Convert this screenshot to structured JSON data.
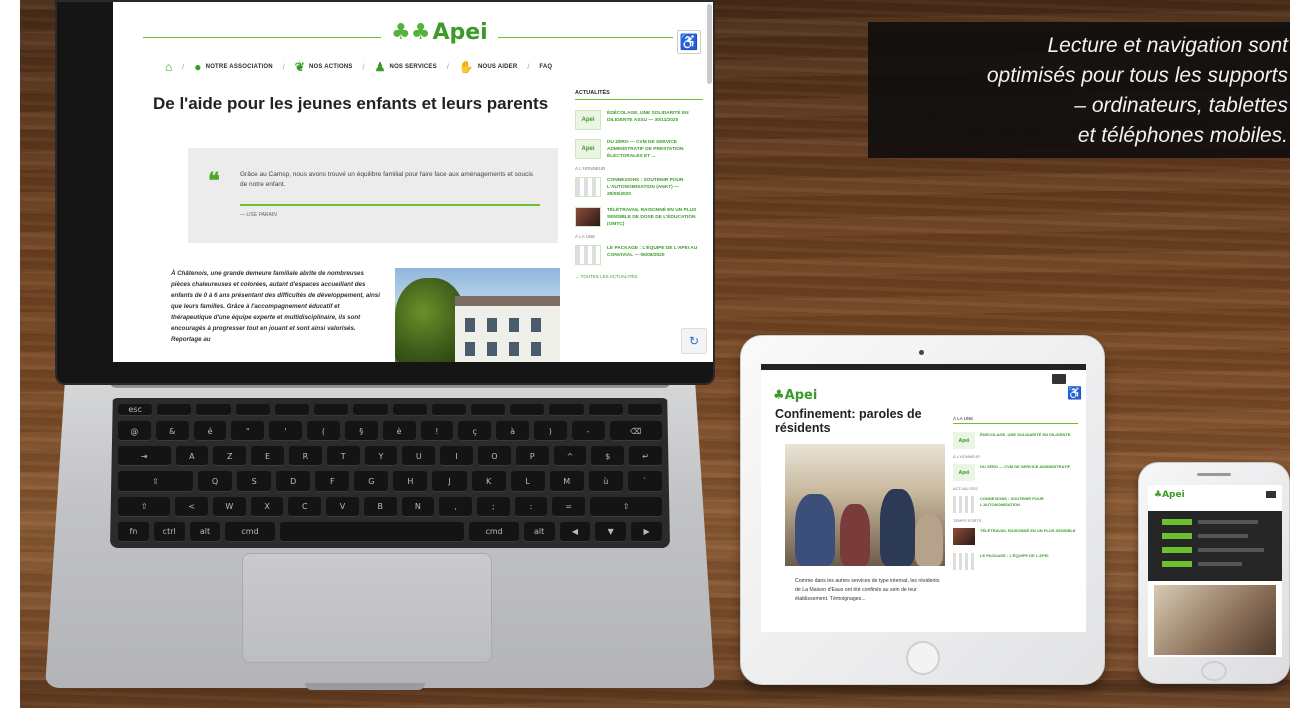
{
  "caption": {
    "line1": "Lecture et navigation sont",
    "line2": "optimisés pour tous les supports",
    "line3": "– ordinateurs, tablettes",
    "line4": "et téléphones mobiles."
  },
  "laptop_site": {
    "logo": "Apei",
    "nav": [
      "NOTRE ASSOCIATION",
      "NOS ACTIONS",
      "NOS SERVICES",
      "NOUS AIDER",
      "FAQ"
    ],
    "title": "De l'aide pour les jeunes enfants et leurs parents",
    "quote": "Grâce au Camsp, nous avons trouvé un équilibre familial pour faire face aux aménagements et soucis de notre enfant.",
    "quote_author": "— LISE PARAIN",
    "body": "À Châtenois, une grande demeure familiale abrite de nombreuses pièces chaleureuses et colorées, autant d'espaces accueillant des enfants de 0 à 6 ans présentant des difficultés de développement, ainsi que leurs familles. Grâce à l'accompagnement éducatif et thérapeutique d'une équipe experte et multidisciplinaire, ils sont encouragés à progresser tout en jouant et sont ainsi valorisés. Reportage au",
    "sidebar_header": "ACTUALITÉS",
    "sidebar_items": [
      {
        "thumb": "Apei",
        "text": "ÉDÉCOLAGE, UNE SOLIDARITÉ EN DILIGENTE ASSU — 30/11/2020"
      },
      {
        "thumb": "Apei",
        "text": "DU ZÉRO — CVM DE SERVICE ADMINISTRATIF DE PRESTATION ÉLECTORALES ET ..."
      },
      {
        "thumb": "",
        "text": "CONNEXIONS : SOUTENIR POUR L'AUTONOMISATION (ANKT) — 29/09/2020"
      },
      {
        "thumb": "",
        "text": "TÉLÉTRAVAIL RAISONNÉ EN UN PLUS SENSIBLE DE DOSE DE L'ÉDUCATION (OMTC)"
      },
      {
        "thumb": "",
        "text": "LE PACKAGE : L'ÉQUIPE DE L'APEI AU CONVIVIAL — 06/08/2020"
      }
    ],
    "sidebar_cats": [
      "À L'HONNEUR",
      "À LA UNE"
    ],
    "sidebar_more": "→ TOUTES LES ACTUALITÉS"
  },
  "tablet_site": {
    "logo": "Apei",
    "title": "Confinement: paroles de résidents",
    "text": "Comme dans les autres services de type internat, les résidents de La Maison d'Eaux ont été confinés au sein de leur établissement. Témoignages...",
    "sidebar_header": "À LA UNE",
    "sidebar_items": [
      {
        "thumb": "Apei",
        "text": "ÉDÉCOLAGE, UNE SOLIDARITÉ EN DILIGENTE"
      },
      {
        "thumb": "Apei",
        "text": "DU ZÉRO — CVM DE SERVICE ADMINISTRATIF"
      },
      {
        "thumb": "",
        "text": "CONNEXIONS : SOUTENIR POUR L'AUTONOMISATION"
      },
      {
        "thumb": "",
        "text": "TÉLÉTRAVAIL RAISONNÉ EN UN PLUS SENSIBLE"
      },
      {
        "thumb": "",
        "text": "LE PACKAGE : L'ÉQUIPE DE L'APEI"
      }
    ],
    "sidebar_cats": [
      "À L'HONNEUR",
      "ACTUALITÉS",
      "TEMPS FORTS"
    ]
  },
  "phone_site": {
    "logo": "Apei"
  },
  "colors": {
    "brand_green": "#3a9b2a",
    "accent_green": "#6cbf2f",
    "caption_bg": "#0c0c0c",
    "wood": "#6b3f1f"
  },
  "icons": [
    "home-icon",
    "people-icon",
    "heart-hands-icon",
    "accessibility-icon",
    "recaptcha-icon",
    "quote-mark-icon"
  ]
}
